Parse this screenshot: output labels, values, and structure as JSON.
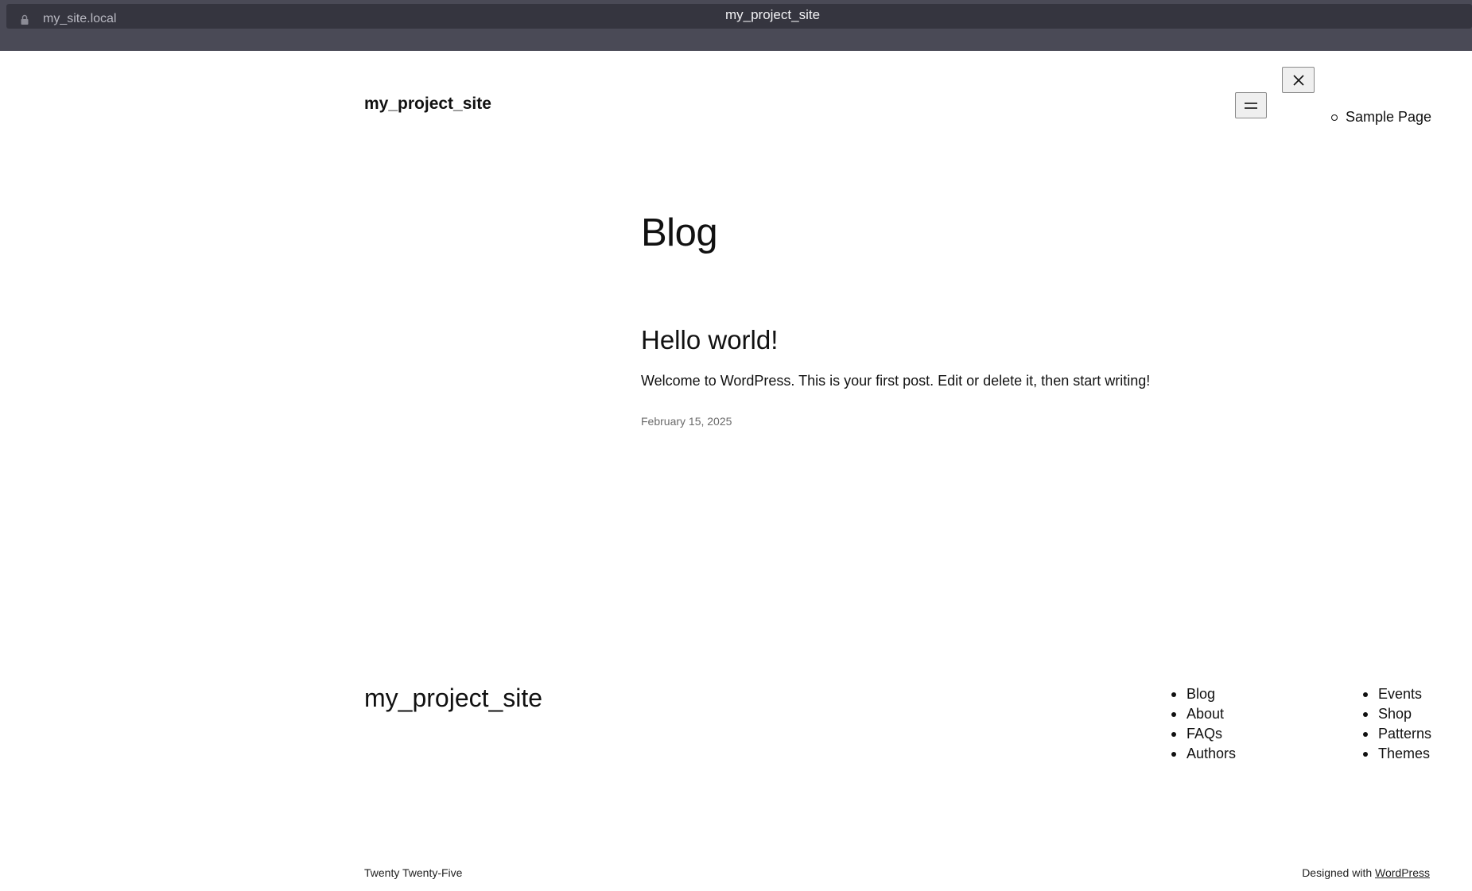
{
  "browser": {
    "url": "my_site.local",
    "tab_title": "my_project_site"
  },
  "header": {
    "site_title": "my_project_site",
    "menu_items": [
      "Sample Page"
    ]
  },
  "main": {
    "heading": "Blog",
    "posts": [
      {
        "title": "Hello world!",
        "excerpt": "Welcome to WordPress. This is your first post. Edit or delete it, then start writing!",
        "date": "February 15, 2025"
      }
    ]
  },
  "footer": {
    "site_title": "my_project_site",
    "nav_left": [
      "Blog",
      "About",
      "FAQs",
      "Authors"
    ],
    "nav_right": [
      "Events",
      "Shop",
      "Patterns",
      "Themes"
    ],
    "theme_credit": "Twenty Twenty-Five",
    "designed_with": "Designed with",
    "designed_with_link": "WordPress"
  },
  "icons": {
    "lock": "lock-icon",
    "menu_open": "hamburger-icon",
    "menu_close": "close-icon"
  },
  "colors": {
    "chrome_bg": "#4a4a56",
    "url_strip_bg": "#35353f",
    "text": "#111111",
    "muted": "#6b6b6b"
  }
}
